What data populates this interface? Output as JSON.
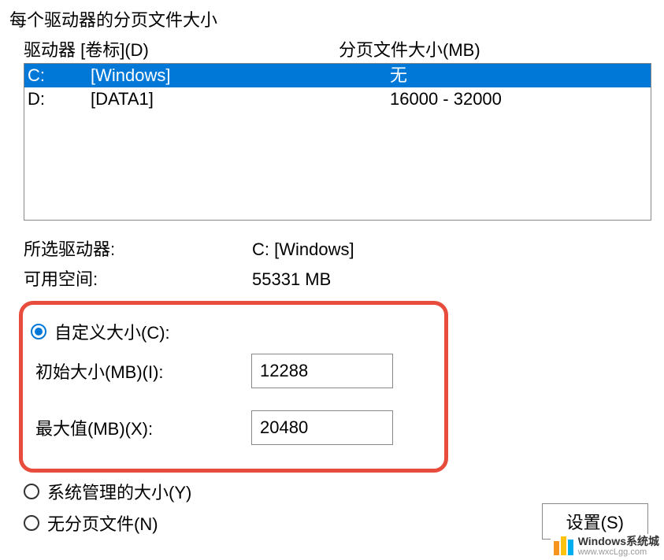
{
  "section_title": "每个驱动器的分页文件大小",
  "headers": {
    "drive": "驱动器 [卷标](D)",
    "size": "分页文件大小(MB)"
  },
  "drives": [
    {
      "letter": "C:",
      "label": "[Windows]",
      "size": "无",
      "selected": true
    },
    {
      "letter": "D:",
      "label": "[DATA1]",
      "size": "16000 - 32000",
      "selected": false
    }
  ],
  "info": {
    "selected_label": "所选驱动器:",
    "selected_value": "C:  [Windows]",
    "free_label": "可用空间:",
    "free_value": "55331 MB"
  },
  "radios": {
    "custom": "自定义大小(C):",
    "system": "系统管理的大小(Y)",
    "none": "无分页文件(N)"
  },
  "inputs": {
    "initial_label": "初始大小(MB)(I):",
    "initial_value": "12288",
    "max_label": "最大值(MB)(X):",
    "max_value": "20480"
  },
  "set_button": "设置(S)",
  "watermark": {
    "title": "Windows系统城",
    "url": "www.wxcLgg.com"
  }
}
